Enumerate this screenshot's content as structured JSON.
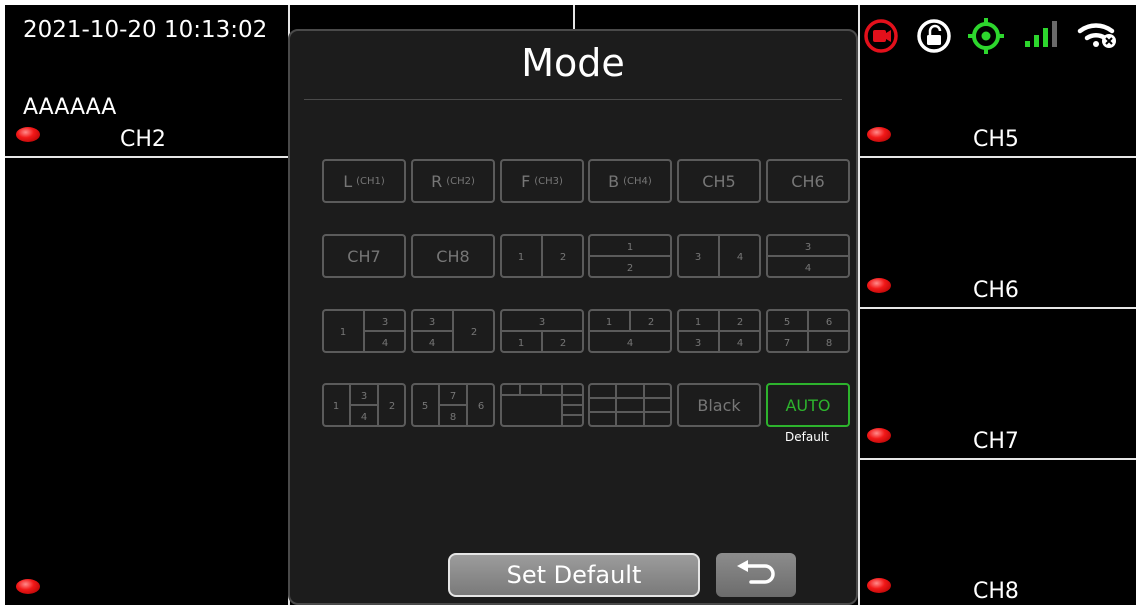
{
  "timestamp": "2021-10-20 10:13:02",
  "overlay_text": "AAAAAA",
  "channels": {
    "ch2": "CH2",
    "ch5": "CH5",
    "ch6": "CH6",
    "ch7": "CH7",
    "ch8": "CH8"
  },
  "status_icons": [
    "record-icon",
    "unlock-icon",
    "gps-icon",
    "signal-icon",
    "wifi-off-icon"
  ],
  "colors": {
    "record": "#e3101b",
    "gps": "#2dd62d",
    "signal": "#2dd62d",
    "auto": "#2db32d",
    "led": "#f21818"
  },
  "dialog": {
    "title": "Mode",
    "buttons": [
      {
        "label": "L",
        "sub": "(CH1)"
      },
      {
        "label": "R",
        "sub": "(CH2)"
      },
      {
        "label": "F",
        "sub": "(CH3)"
      },
      {
        "label": "B",
        "sub": "(CH4)"
      },
      {
        "label": "CH5"
      },
      {
        "label": "CH6"
      },
      {
        "label": "CH7"
      },
      {
        "label": "CH8"
      }
    ],
    "layout_numbers": {
      "l1": [
        "1",
        "2"
      ],
      "l2": [
        "1",
        "2"
      ],
      "l3": [
        "3",
        "4"
      ],
      "l4": [
        "3",
        "4"
      ],
      "l5": [
        "1",
        "3",
        "4"
      ],
      "l6": [
        "3",
        "4",
        "2"
      ],
      "l7": [
        "3",
        "1",
        "2"
      ],
      "l8": [
        "1",
        "2",
        "4"
      ],
      "l9": [
        "1",
        "2",
        "3",
        "4"
      ],
      "l10": [
        "5",
        "6",
        "7",
        "8"
      ],
      "l11": [
        "1",
        "3",
        "4",
        "2"
      ],
      "l12": [
        "5",
        "7",
        "8",
        "6"
      ]
    },
    "black_label": "Black",
    "auto_label": "AUTO",
    "default_caption": "Default",
    "set_default_label": "Set Default",
    "back_icon": "return-arrow-icon"
  }
}
